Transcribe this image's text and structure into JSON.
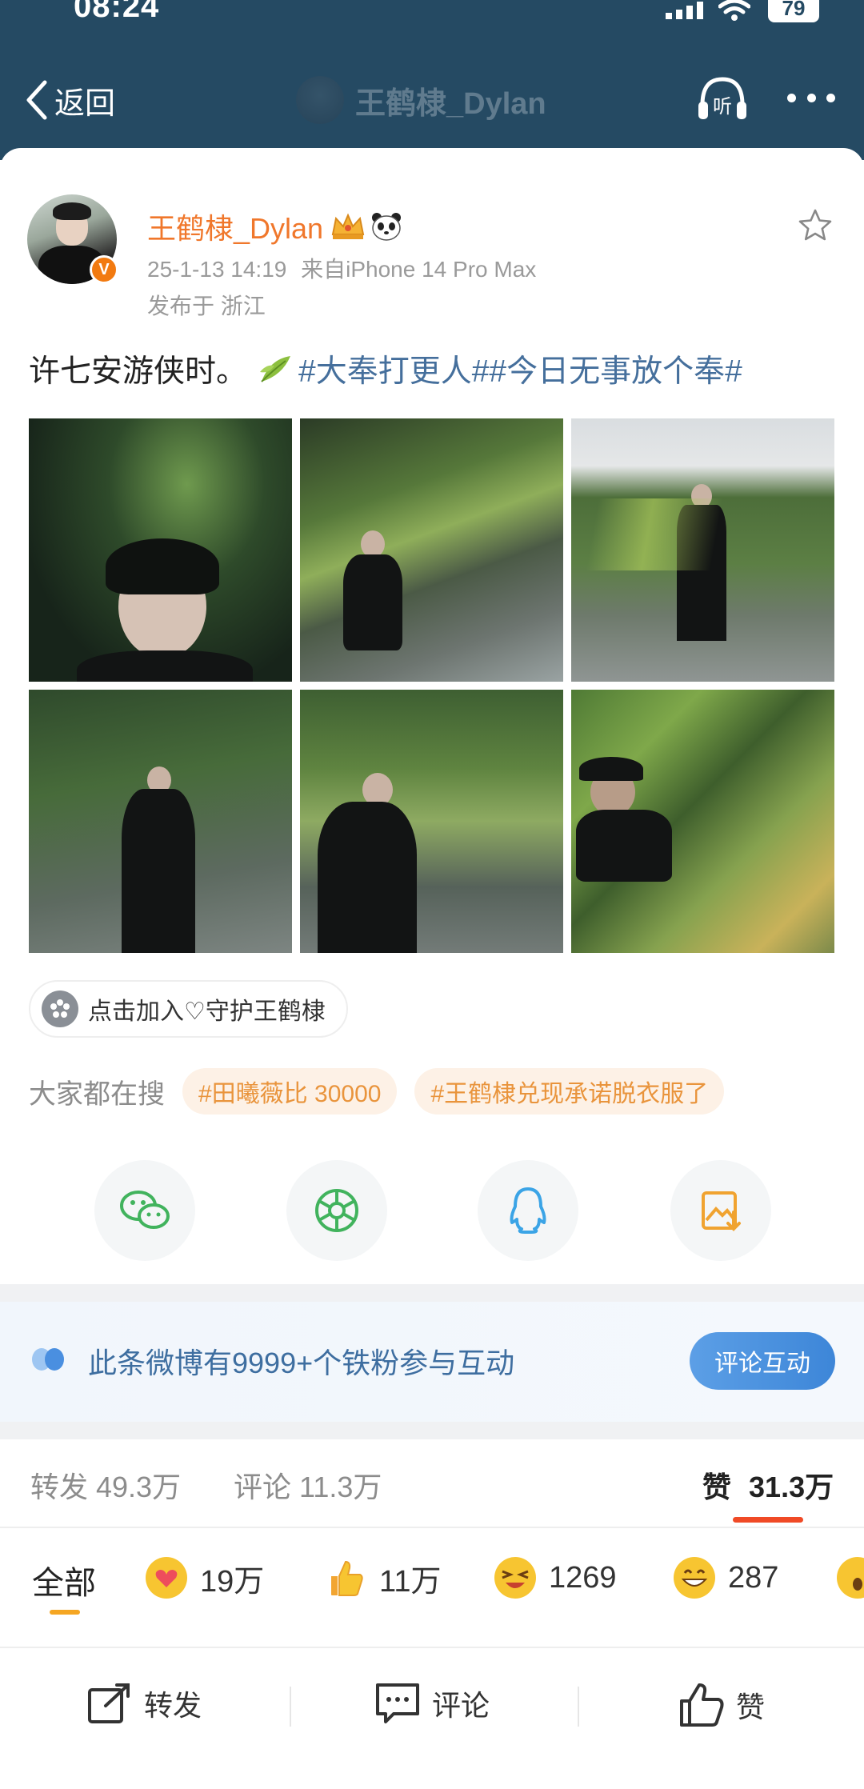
{
  "status_bar": {
    "time": "08:24",
    "battery": "79"
  },
  "nav": {
    "back_label": "返回",
    "title": "王鹤棣_Dylan",
    "listen_label": "听"
  },
  "post": {
    "username": "王鹤棣_Dylan",
    "verified_badge": "V",
    "timestamp": "25-1-13 14:19",
    "source": "来自iPhone 14 Pro Max",
    "location": "发布于 浙江",
    "text": "许七安游侠时。",
    "hashtags": "#大奉打更人##今日无事放个奉#"
  },
  "support": {
    "label": "点击加入♡守护王鹤棣"
  },
  "search": {
    "label": "大家都在搜",
    "chips": [
      "#田曦薇比 30000",
      "#王鹤棣兑现承诺脱衣服了"
    ]
  },
  "share_icons": [
    "wechat-icon",
    "moments-icon",
    "qq-icon",
    "save-image-icon"
  ],
  "fan_banner": {
    "text": "此条微博有9999+个铁粉参与互动",
    "button": "评论互动"
  },
  "stats": {
    "repost": "转发 49.3万",
    "comment": "评论 11.3万",
    "like_label": "赞",
    "like_count": "31.3万"
  },
  "reactions": {
    "all": "全部",
    "items": [
      {
        "icon": "heart-face-icon",
        "count": "19万"
      },
      {
        "icon": "thumbs-up-icon",
        "count": "11万"
      },
      {
        "icon": "squint-laugh-icon",
        "count": "1269"
      },
      {
        "icon": "grin-icon",
        "count": "287"
      }
    ]
  },
  "actions": {
    "repost": "转发",
    "comment": "评论",
    "like": "赞"
  },
  "colors": {
    "header_bg": "#254a63",
    "username": "#f0772b",
    "hashtag": "#456f9c",
    "chip_text": "#e9943c",
    "like_underline": "#f04a26",
    "fan_button": "#3d86d8"
  }
}
